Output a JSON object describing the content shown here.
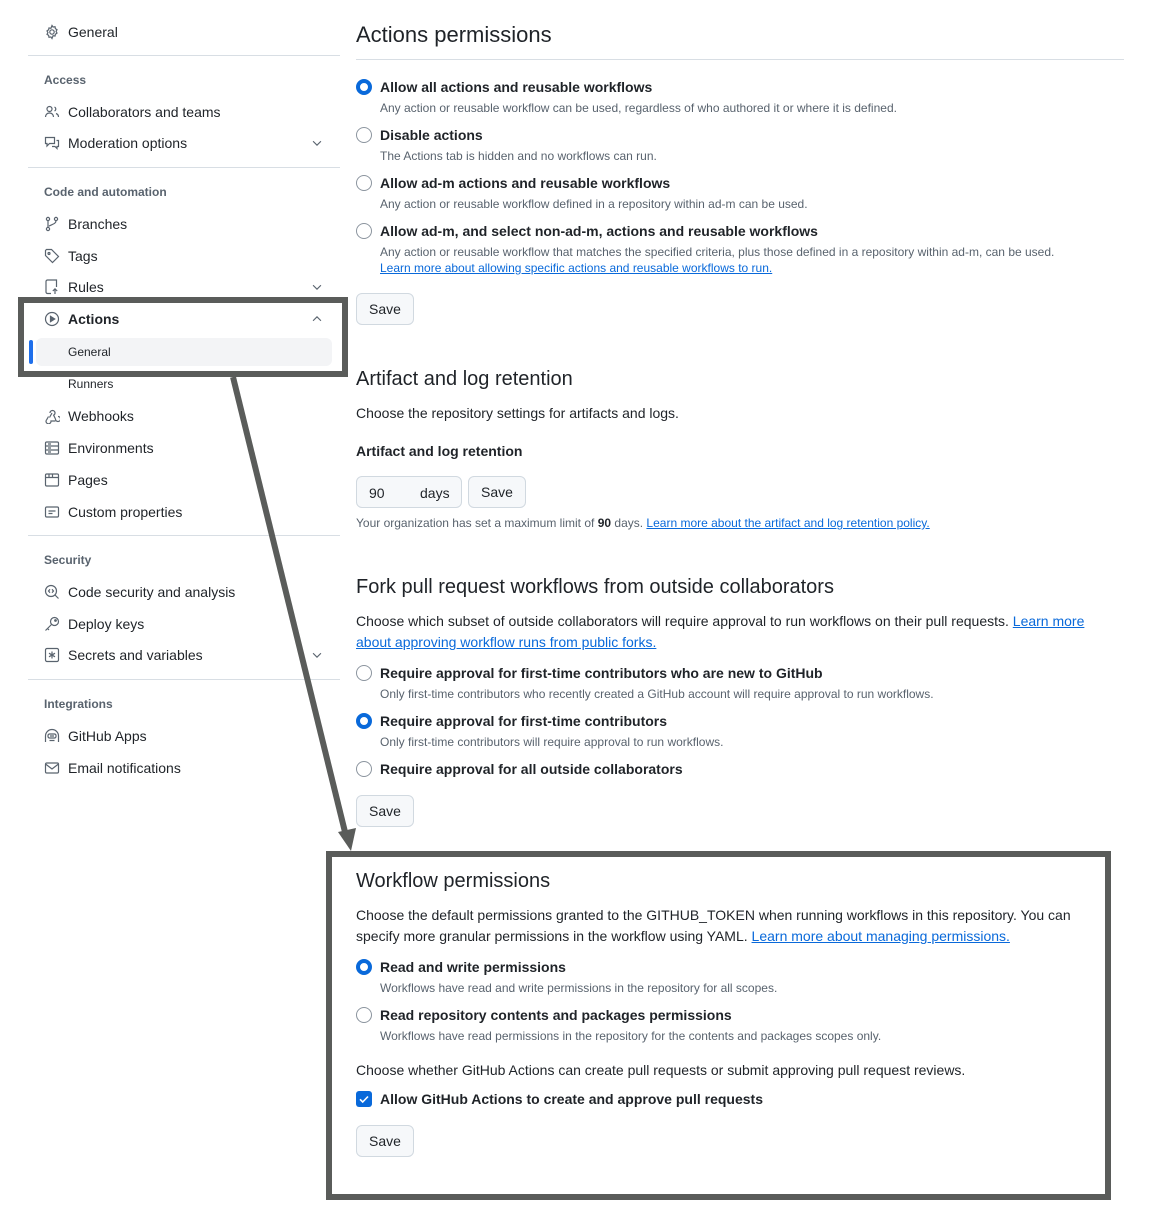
{
  "sidebar": {
    "top_item": {
      "label": "General",
      "icon": "gear-icon"
    },
    "groups": [
      {
        "title": "Access",
        "items": [
          {
            "label": "Collaborators and teams",
            "icon": "people-icon"
          },
          {
            "label": "Moderation options",
            "icon": "comment-discussion-icon",
            "expandable": true
          }
        ]
      },
      {
        "title": "Code and automation",
        "items": [
          {
            "label": "Branches",
            "icon": "git-branch-icon"
          },
          {
            "label": "Tags",
            "icon": "tag-icon"
          },
          {
            "label": "Rules",
            "icon": "repo-push-icon",
            "expandable": true
          },
          {
            "label": "Actions",
            "icon": "play-icon",
            "expanded": true,
            "subitems": [
              {
                "label": "General",
                "active": true
              },
              {
                "label": "Runners"
              }
            ]
          },
          {
            "label": "Webhooks",
            "icon": "webhook-icon"
          },
          {
            "label": "Environments",
            "icon": "server-icon"
          },
          {
            "label": "Pages",
            "icon": "browser-icon"
          },
          {
            "label": "Custom properties",
            "icon": "note-icon"
          }
        ]
      },
      {
        "title": "Security",
        "items": [
          {
            "label": "Code security and analysis",
            "icon": "codescan-icon"
          },
          {
            "label": "Deploy keys",
            "icon": "key-icon"
          },
          {
            "label": "Secrets and variables",
            "icon": "key-asterisk-icon",
            "expandable": true
          }
        ]
      },
      {
        "title": "Integrations",
        "items": [
          {
            "label": "GitHub Apps",
            "icon": "hubot-icon"
          },
          {
            "label": "Email notifications",
            "icon": "mail-icon"
          }
        ]
      }
    ]
  },
  "actions_permissions": {
    "title": "Actions permissions",
    "options": [
      {
        "label": "Allow all actions and reusable workflows",
        "note": "Any action or reusable workflow can be used, regardless of who authored it or where it is defined.",
        "selected": true
      },
      {
        "label": "Disable actions",
        "note": "The Actions tab is hidden and no workflows can run.",
        "selected": false
      },
      {
        "label": "Allow ad-m actions and reusable workflows",
        "note": "Any action or reusable workflow defined in a repository within ad-m can be used.",
        "selected": false
      },
      {
        "label": "Allow ad-m, and select non-ad-m, actions and reusable workflows",
        "note": "Any action or reusable workflow that matches the specified criteria, plus those defined in a repository within ad-m, can be used.",
        "link": "Learn more about allowing specific actions and reusable workflows to run.",
        "selected": false
      }
    ],
    "save_label": "Save"
  },
  "artifact_retention": {
    "title": "Artifact and log retention",
    "description": "Choose the repository settings for artifacts and logs.",
    "field_label": "Artifact and log retention",
    "value": "90",
    "unit": "days",
    "save_label": "Save",
    "note_prefix": "Your organization has set a maximum limit of",
    "note_value": "90",
    "note_suffix": "days.",
    "note_link": "Learn more about the artifact and log retention policy."
  },
  "fork_pr": {
    "title": "Fork pull request workflows from outside collaborators",
    "description": "Choose which subset of outside collaborators will require approval to run workflows on their pull requests.",
    "link_line1": "Learn more",
    "link_line2": "about approving workflow runs from public forks.",
    "options": [
      {
        "label": "Require approval for first-time contributors who are new to GitHub",
        "note": "Only first-time contributors who recently created a GitHub account will require approval to run workflows.",
        "selected": false
      },
      {
        "label": "Require approval for first-time contributors",
        "note": "Only first-time contributors will require approval to run workflows.",
        "selected": true
      },
      {
        "label": "Require approval for all outside collaborators",
        "note": "",
        "selected": false
      }
    ],
    "save_label": "Save"
  },
  "workflow_permissions": {
    "title": "Workflow permissions",
    "description_line1": "Choose the default permissions granted to the GITHUB_TOKEN when running workflows in this repository. You can",
    "description_line2": "specify more granular permissions in the workflow using YAML.",
    "link": "Learn more about managing permissions.",
    "options": [
      {
        "label": "Read and write permissions",
        "note": "Workflows have read and write permissions in the repository for all scopes.",
        "selected": true
      },
      {
        "label": "Read repository contents and packages permissions",
        "note": "Workflows have read permissions in the repository for the contents and packages scopes only.",
        "selected": false
      }
    ],
    "pr_description": "Choose whether GitHub Actions can create pull requests or submit approving pull request reviews.",
    "checkbox_label": "Allow GitHub Actions to create and approve pull requests",
    "checkbox_checked": true,
    "save_label": "Save"
  },
  "colors": {
    "accent": "#0969da",
    "annotation": "#5a5c5a",
    "active_bar": "#1f6feb"
  }
}
